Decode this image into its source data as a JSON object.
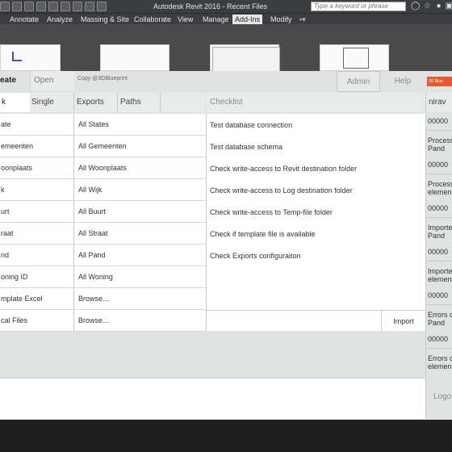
{
  "titlebar": {
    "app_title": "Autodesk Revit 2016 -    Recent Files",
    "search_placeholder": "Type a keyword or phrase",
    "icons": [
      "binoculars-icon",
      "star-icon",
      "user-icon",
      "cart-icon"
    ]
  },
  "ribbon": {
    "tabs": [
      "Annotate",
      "Analyze",
      "Massing & Site",
      "Collaborate",
      "View",
      "Manage",
      "Add-Ins",
      "Modify"
    ],
    "active_tab": "Add-Ins"
  },
  "dialog": {
    "top_tabs": {
      "create": "eate",
      "open": "Open",
      "admin": "Admin",
      "help": "Help"
    },
    "copyright": "Copy @3DBlueprint",
    "sub_tabs": {
      "bulk": "k",
      "single": "Single",
      "exports": "Exports",
      "paths": "Paths"
    },
    "rows": [
      {
        "left": "ate",
        "right": "All States"
      },
      {
        "left": "emeenten",
        "right": "All Gemeenten"
      },
      {
        "left": "oonplaats",
        "right": "All Woonplaats"
      },
      {
        "left": "k",
        "right": "All Wijk"
      },
      {
        "left": "urt",
        "right": "All Buurt"
      },
      {
        "left": "raat",
        "right": "All Straat"
      },
      {
        "left": "nd",
        "right": "All Pand"
      },
      {
        "left": "oning ID",
        "right": "All Woning"
      },
      {
        "left": "mplate Excel",
        "right": "Browse..."
      },
      {
        "left": "cal Files",
        "right": "Browse..."
      }
    ],
    "import_label": "Import",
    "checklist": {
      "title": "Checklist",
      "items": [
        "Test database connection",
        "Test database schema",
        "Check write-access to Revit destination folder",
        "Check write-access to Log destination folder",
        "Check write-access to Temp-file folder",
        "Check if template file is available",
        "Check Exports configuraiton"
      ]
    },
    "status": {
      "user": "nirav",
      "counters": [
        {
          "value": "00000",
          "line1": "Process",
          "line2": "Pand"
        },
        {
          "value": "00000",
          "line1": "Process",
          "line2": "element"
        },
        {
          "value": "00000",
          "line1": "Importe",
          "line2": "Pand"
        },
        {
          "value": "00000",
          "line1": "Importe",
          "line2": "element"
        },
        {
          "value": "00000",
          "line1": "Errors c",
          "line2": "Pand"
        },
        {
          "value": "00000",
          "line1": "Errors c",
          "line2": "element"
        }
      ],
      "logo_text": "Logo"
    },
    "brand_logo_text": "3D Blue"
  }
}
